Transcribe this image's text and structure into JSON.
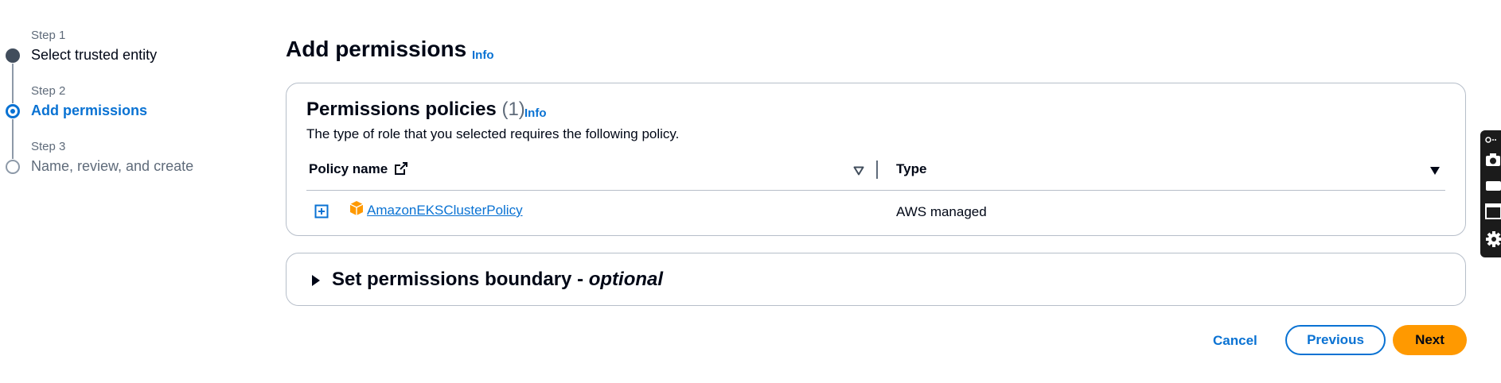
{
  "wizard": {
    "steps": [
      {
        "number": "Step 1",
        "title": "Select trusted entity",
        "state": "complete"
      },
      {
        "number": "Step 2",
        "title": "Add permissions",
        "state": "active"
      },
      {
        "number": "Step 3",
        "title": "Name, review, and create",
        "state": "pending"
      }
    ]
  },
  "header": {
    "title": "Add permissions",
    "info": "Info"
  },
  "policies": {
    "title": "Permissions policies",
    "count": "(1)",
    "info": "Info",
    "description": "The type of role that you selected requires the following policy.",
    "columns": {
      "name": "Policy name",
      "type": "Type"
    },
    "rows": [
      {
        "name": "AmazonEKSClusterPolicy",
        "type": "AWS managed"
      }
    ]
  },
  "boundary": {
    "title": "Set permissions boundary - ",
    "optional": "optional"
  },
  "actions": {
    "cancel": "Cancel",
    "previous": "Previous",
    "next": "Next"
  },
  "colors": {
    "link": "#0972d3",
    "primary_button": "#ff9900",
    "border": "#b6bec9",
    "text": "#000716"
  },
  "icons": [
    "external-link-icon",
    "sort-icon",
    "expand-icon",
    "policy-box-icon",
    "caret-right-icon",
    "camera-icon",
    "video-icon",
    "window-icon",
    "settings-icon"
  ]
}
